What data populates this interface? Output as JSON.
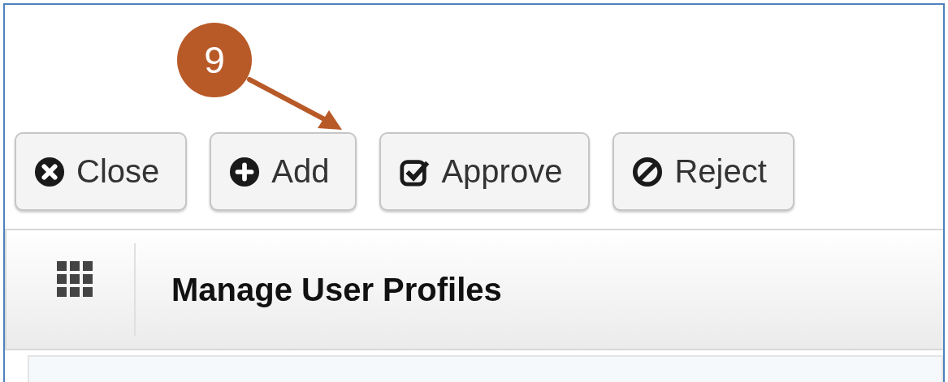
{
  "annotation": {
    "number": "9"
  },
  "toolbar": {
    "buttons": [
      {
        "label": "Close",
        "kind": "close"
      },
      {
        "label": "Add",
        "kind": "add"
      },
      {
        "label": "Approve",
        "kind": "approve"
      },
      {
        "label": "Reject",
        "kind": "reject"
      }
    ]
  },
  "panel": {
    "title": "Manage User Profiles"
  }
}
